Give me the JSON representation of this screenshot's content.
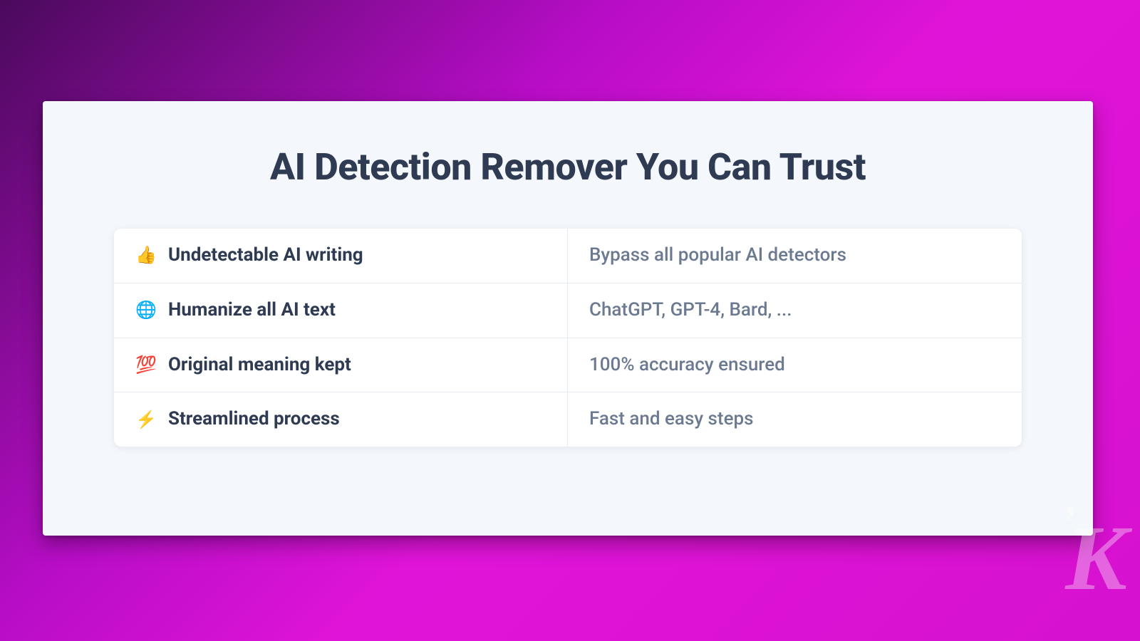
{
  "page": {
    "title": "AI Detection Remover You Can Trust"
  },
  "rows": [
    {
      "icon": "👍",
      "feature": "Undetectable AI writing",
      "detail": "Bypass all popular AI detectors"
    },
    {
      "icon": "🌐",
      "feature": "Humanize all AI text",
      "detail": "ChatGPT, GPT-4, Bard, ..."
    },
    {
      "icon": "💯",
      "feature": "Original meaning kept",
      "detail": "100% accuracy ensured"
    },
    {
      "icon": "⚡",
      "feature": "Streamlined process",
      "detail": "Fast and easy steps"
    }
  ],
  "watermark": {
    "dot": "’",
    "letter": "K"
  }
}
